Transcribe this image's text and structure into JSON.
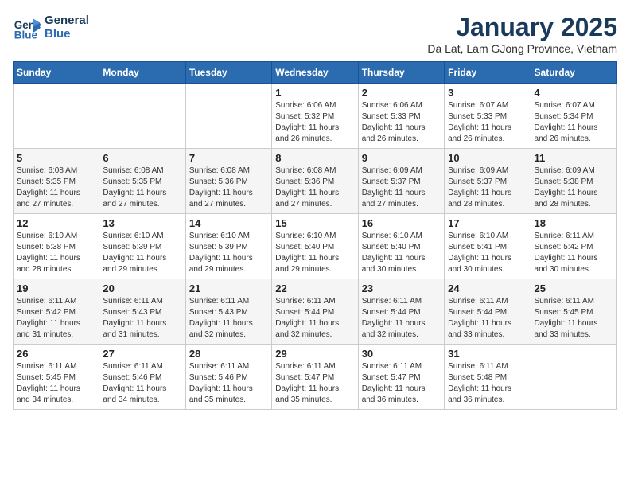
{
  "header": {
    "logo": {
      "line1": "General",
      "line2": "Blue"
    },
    "title": "January 2025",
    "subtitle": "Da Lat, Lam GJong Province, Vietnam"
  },
  "weekdays": [
    "Sunday",
    "Monday",
    "Tuesday",
    "Wednesday",
    "Thursday",
    "Friday",
    "Saturday"
  ],
  "weeks": [
    [
      {
        "day": "",
        "info": ""
      },
      {
        "day": "",
        "info": ""
      },
      {
        "day": "",
        "info": ""
      },
      {
        "day": "1",
        "info": "Sunrise: 6:06 AM\nSunset: 5:32 PM\nDaylight: 11 hours\nand 26 minutes."
      },
      {
        "day": "2",
        "info": "Sunrise: 6:06 AM\nSunset: 5:33 PM\nDaylight: 11 hours\nand 26 minutes."
      },
      {
        "day": "3",
        "info": "Sunrise: 6:07 AM\nSunset: 5:33 PM\nDaylight: 11 hours\nand 26 minutes."
      },
      {
        "day": "4",
        "info": "Sunrise: 6:07 AM\nSunset: 5:34 PM\nDaylight: 11 hours\nand 26 minutes."
      }
    ],
    [
      {
        "day": "5",
        "info": "Sunrise: 6:08 AM\nSunset: 5:35 PM\nDaylight: 11 hours\nand 27 minutes."
      },
      {
        "day": "6",
        "info": "Sunrise: 6:08 AM\nSunset: 5:35 PM\nDaylight: 11 hours\nand 27 minutes."
      },
      {
        "day": "7",
        "info": "Sunrise: 6:08 AM\nSunset: 5:36 PM\nDaylight: 11 hours\nand 27 minutes."
      },
      {
        "day": "8",
        "info": "Sunrise: 6:08 AM\nSunset: 5:36 PM\nDaylight: 11 hours\nand 27 minutes."
      },
      {
        "day": "9",
        "info": "Sunrise: 6:09 AM\nSunset: 5:37 PM\nDaylight: 11 hours\nand 27 minutes."
      },
      {
        "day": "10",
        "info": "Sunrise: 6:09 AM\nSunset: 5:37 PM\nDaylight: 11 hours\nand 28 minutes."
      },
      {
        "day": "11",
        "info": "Sunrise: 6:09 AM\nSunset: 5:38 PM\nDaylight: 11 hours\nand 28 minutes."
      }
    ],
    [
      {
        "day": "12",
        "info": "Sunrise: 6:10 AM\nSunset: 5:38 PM\nDaylight: 11 hours\nand 28 minutes."
      },
      {
        "day": "13",
        "info": "Sunrise: 6:10 AM\nSunset: 5:39 PM\nDaylight: 11 hours\nand 29 minutes."
      },
      {
        "day": "14",
        "info": "Sunrise: 6:10 AM\nSunset: 5:39 PM\nDaylight: 11 hours\nand 29 minutes."
      },
      {
        "day": "15",
        "info": "Sunrise: 6:10 AM\nSunset: 5:40 PM\nDaylight: 11 hours\nand 29 minutes."
      },
      {
        "day": "16",
        "info": "Sunrise: 6:10 AM\nSunset: 5:40 PM\nDaylight: 11 hours\nand 30 minutes."
      },
      {
        "day": "17",
        "info": "Sunrise: 6:10 AM\nSunset: 5:41 PM\nDaylight: 11 hours\nand 30 minutes."
      },
      {
        "day": "18",
        "info": "Sunrise: 6:11 AM\nSunset: 5:42 PM\nDaylight: 11 hours\nand 30 minutes."
      }
    ],
    [
      {
        "day": "19",
        "info": "Sunrise: 6:11 AM\nSunset: 5:42 PM\nDaylight: 11 hours\nand 31 minutes."
      },
      {
        "day": "20",
        "info": "Sunrise: 6:11 AM\nSunset: 5:43 PM\nDaylight: 11 hours\nand 31 minutes."
      },
      {
        "day": "21",
        "info": "Sunrise: 6:11 AM\nSunset: 5:43 PM\nDaylight: 11 hours\nand 32 minutes."
      },
      {
        "day": "22",
        "info": "Sunrise: 6:11 AM\nSunset: 5:44 PM\nDaylight: 11 hours\nand 32 minutes."
      },
      {
        "day": "23",
        "info": "Sunrise: 6:11 AM\nSunset: 5:44 PM\nDaylight: 11 hours\nand 32 minutes."
      },
      {
        "day": "24",
        "info": "Sunrise: 6:11 AM\nSunset: 5:44 PM\nDaylight: 11 hours\nand 33 minutes."
      },
      {
        "day": "25",
        "info": "Sunrise: 6:11 AM\nSunset: 5:45 PM\nDaylight: 11 hours\nand 33 minutes."
      }
    ],
    [
      {
        "day": "26",
        "info": "Sunrise: 6:11 AM\nSunset: 5:45 PM\nDaylight: 11 hours\nand 34 minutes."
      },
      {
        "day": "27",
        "info": "Sunrise: 6:11 AM\nSunset: 5:46 PM\nDaylight: 11 hours\nand 34 minutes."
      },
      {
        "day": "28",
        "info": "Sunrise: 6:11 AM\nSunset: 5:46 PM\nDaylight: 11 hours\nand 35 minutes."
      },
      {
        "day": "29",
        "info": "Sunrise: 6:11 AM\nSunset: 5:47 PM\nDaylight: 11 hours\nand 35 minutes."
      },
      {
        "day": "30",
        "info": "Sunrise: 6:11 AM\nSunset: 5:47 PM\nDaylight: 11 hours\nand 36 minutes."
      },
      {
        "day": "31",
        "info": "Sunrise: 6:11 AM\nSunset: 5:48 PM\nDaylight: 11 hours\nand 36 minutes."
      },
      {
        "day": "",
        "info": ""
      }
    ]
  ]
}
